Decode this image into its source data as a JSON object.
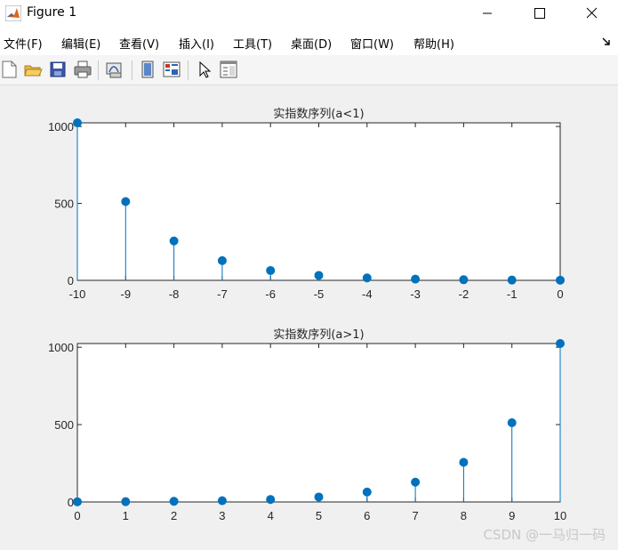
{
  "window": {
    "title": "Figure 1",
    "icon": "matlab-icon"
  },
  "menu": {
    "items": [
      "文件(F)",
      "编辑(E)",
      "查看(V)",
      "插入(I)",
      "工具(T)",
      "桌面(D)",
      "窗口(W)",
      "帮助(H)"
    ]
  },
  "toolbar": {
    "icons": [
      "new-figure-icon",
      "open-file-icon",
      "save-icon",
      "print-icon",
      "link-plot-icon",
      "hide-plot-tools-icon",
      "show-plot-tools-icon",
      "edit-plot-icon",
      "open-property-inspector-icon"
    ]
  },
  "watermark": "CSDN @一马归一码",
  "colors": {
    "stem": "#0072bd"
  },
  "chart_data": [
    {
      "type": "stem",
      "title": "实指数序列(a<1)",
      "x": [
        -10,
        -9,
        -8,
        -7,
        -6,
        -5,
        -4,
        -3,
        -2,
        -1,
        0
      ],
      "values": [
        1024,
        512,
        256,
        128,
        64,
        32,
        16,
        8,
        4,
        2,
        1
      ],
      "xlim": [
        -10,
        0
      ],
      "ylim": [
        0,
        1024
      ],
      "xticks": [
        "-10",
        "-9",
        "-8",
        "-7",
        "-6",
        "-5",
        "-4",
        "-3",
        "-2",
        "-1",
        "0"
      ],
      "yticks": [
        "0",
        "500",
        "1000"
      ],
      "grid": false
    },
    {
      "type": "stem",
      "title": "实指数序列(a>1)",
      "x": [
        0,
        1,
        2,
        3,
        4,
        5,
        6,
        7,
        8,
        9,
        10
      ],
      "values": [
        1,
        2,
        4,
        8,
        16,
        32,
        64,
        128,
        256,
        512,
        1024
      ],
      "xlim": [
        0,
        10
      ],
      "ylim": [
        0,
        1024
      ],
      "xticks": [
        "0",
        "1",
        "2",
        "3",
        "4",
        "5",
        "6",
        "7",
        "8",
        "9",
        "10"
      ],
      "yticks": [
        "0",
        "500",
        "1000"
      ],
      "grid": false
    }
  ]
}
